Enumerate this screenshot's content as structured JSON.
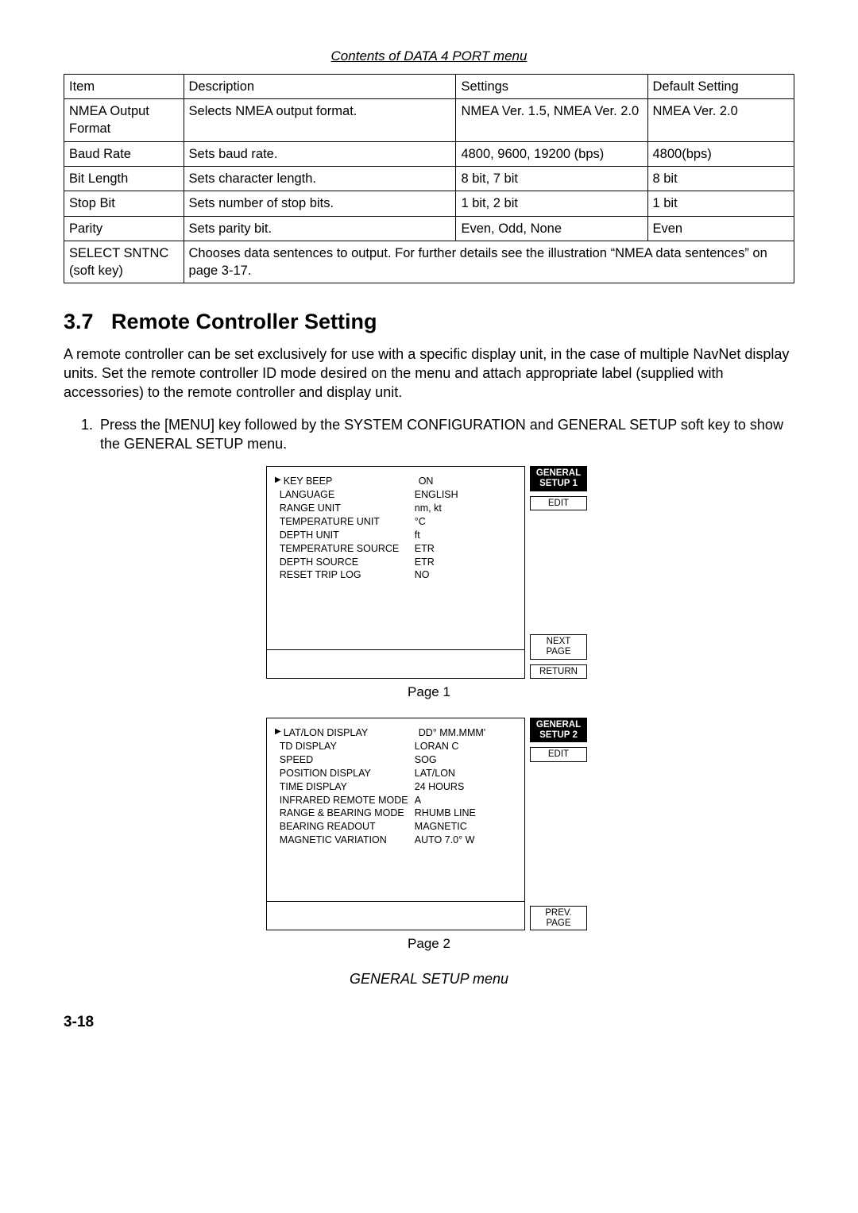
{
  "tableCaption": "Contents of DATA 4 PORT menu",
  "tableHeaders": {
    "item": "Item",
    "desc": "Description",
    "settings": "Settings",
    "default": "Default Setting"
  },
  "rows": [
    {
      "item": "NMEA Output Format",
      "desc": "Selects NMEA output format.",
      "settings": "NMEA Ver. 1.5, NMEA Ver. 2.0",
      "default": "NMEA Ver. 2.0"
    },
    {
      "item": "Baud Rate",
      "desc": "Sets baud rate.",
      "settings": "4800, 9600, 19200 (bps)",
      "default": "4800(bps)"
    },
    {
      "item": "Bit Length",
      "desc": "Sets character length.",
      "settings": "8 bit, 7 bit",
      "default": "8 bit"
    },
    {
      "item": "Stop Bit",
      "desc": "Sets number of stop bits.",
      "settings": "1 bit, 2 bit",
      "default": "1 bit"
    },
    {
      "item": "Parity",
      "desc": "Sets parity bit.",
      "settings": "Even, Odd, None",
      "default": "Even"
    },
    {
      "item": "SELECT SNTNC (soft key)",
      "desc": "Chooses data sentences to output. For further details see the illustration “NMEA data sentences” on page 3-17."
    }
  ],
  "section": {
    "num": "3.7",
    "title": "Remote Controller Setting"
  },
  "intro": "A remote controller can be set exclusively for use with a specific display unit, in the case of multiple NavNet display units. Set the remote controller ID mode desired on the menu and attach appropriate label (supplied with accessories) to the remote controller and display unit.",
  "step1": "Press the [MENU] key followed by the SYSTEM CONFIGURATION and GENERAL SETUP soft key to show the GENERAL SETUP menu.",
  "page1": {
    "title": "GENERAL SETUP 1",
    "soft": {
      "edit": "EDIT",
      "next1": "NEXT",
      "next2": "PAGE",
      "return": "RETURN"
    },
    "rows": [
      {
        "label": "KEY BEEP",
        "value": "ON",
        "sel": true
      },
      {
        "label": "LANGUAGE",
        "value": "ENGLISH"
      },
      {
        "label": "RANGE UNIT",
        "value": "nm, kt"
      },
      {
        "label": "TEMPERATURE UNIT",
        "value": "°C"
      },
      {
        "label": "DEPTH UNIT",
        "value": "ft"
      },
      {
        "label": "TEMPERATURE SOURCE",
        "value": "ETR"
      },
      {
        "label": "DEPTH SOURCE",
        "value": "ETR"
      },
      {
        "label": "RESET TRIP LOG",
        "value": "NO"
      }
    ],
    "caption": "Page 1"
  },
  "page2": {
    "title": "GENERAL SETUP 2",
    "soft": {
      "edit": "EDIT",
      "prev1": "PREV.",
      "prev2": "PAGE"
    },
    "rows": [
      {
        "label": "LAT/LON DISPLAY",
        "value": "DD° MM.MMM'",
        "sel": true
      },
      {
        "label": "TD DISPLAY",
        "value": "LORAN C"
      },
      {
        "label": "SPEED",
        "value": "SOG"
      },
      {
        "label": "POSITION DISPLAY",
        "value": "LAT/LON"
      },
      {
        "label": "TIME DISPLAY",
        "value": "24 HOURS"
      },
      {
        "label": "INFRARED REMOTE MODE",
        "value": "A"
      },
      {
        "label": "RANGE & BEARING MODE",
        "value": "RHUMB LINE"
      },
      {
        "label": "BEARING READOUT",
        "value": "MAGNETIC"
      },
      {
        "label": "MAGNETIC VARIATION",
        "value": "AUTO 7.0° W"
      }
    ],
    "caption": "Page 2"
  },
  "figCaption": "GENERAL SETUP menu",
  "pageNum": "3-18"
}
